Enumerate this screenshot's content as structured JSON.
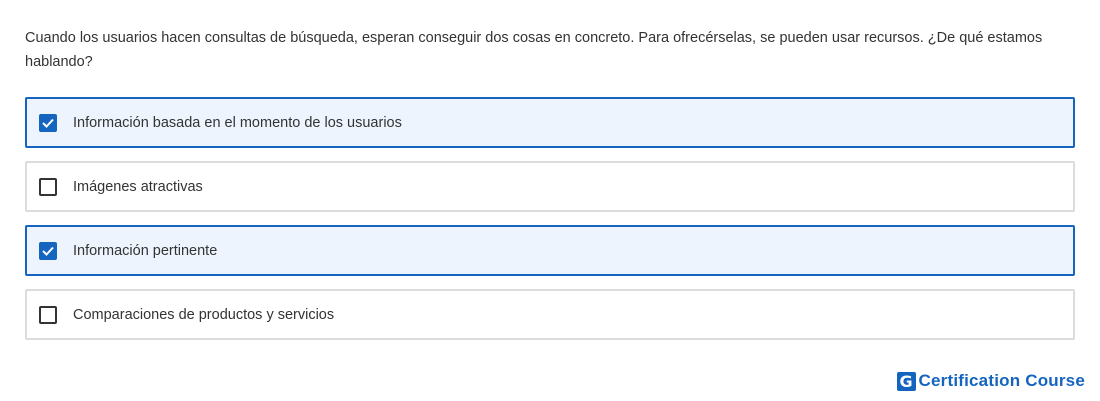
{
  "question": {
    "text": "Cuando los usuarios hacen consultas de búsqueda, esperan conseguir dos cosas en concreto. Para ofrecérselas, se pueden usar recursos. ¿De qué estamos hablando?"
  },
  "options": [
    {
      "label": "Información basada en el momento de los usuarios",
      "checked": true
    },
    {
      "label": "Imágenes atractivas",
      "checked": false
    },
    {
      "label": "Información pertinente",
      "checked": true
    },
    {
      "label": "Comparaciones de productos y servicios",
      "checked": false
    }
  ],
  "brand": {
    "logo_letter": "G",
    "name": "Certification Course"
  },
  "colors": {
    "accent": "#1565c0",
    "selected_background": "#eef4fe",
    "border": "#dcdcdc",
    "text": "#333333"
  },
  "icons": {
    "checked": "checkmark-icon",
    "unchecked": "empty-checkbox-icon"
  }
}
